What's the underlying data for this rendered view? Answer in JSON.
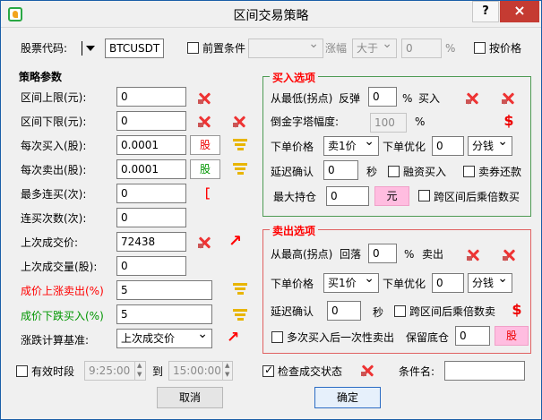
{
  "window": {
    "title": "区间交易策略",
    "help": "?",
    "close": "×"
  },
  "top": {
    "stock_code_label": "股票代码:",
    "symbol": "BTCUSDT",
    "pre_condition_label": "前置条件",
    "rise_label": "涨幅",
    "compare": "大于",
    "percent": "0",
    "percent_unit": "%",
    "by_price_label": "按价格"
  },
  "strategy": {
    "title": "策略参数",
    "rows": [
      {
        "label": "区间上限(元):",
        "value": "0"
      },
      {
        "label": "区间下限(元):",
        "value": "0"
      },
      {
        "label": "每次买入(股):",
        "value": "0.0001",
        "unit": "股"
      },
      {
        "label": "每次卖出(股):",
        "value": "0.0001",
        "unit": "股"
      },
      {
        "label": "最多连买(次):",
        "value": "0"
      },
      {
        "label": "连买次数(次):",
        "value": "0"
      },
      {
        "label": "上次成交价:",
        "value": "72438"
      },
      {
        "label": "上次成交量(股):",
        "value": "0"
      },
      {
        "label": "成价上涨卖出(%)",
        "value": "5"
      },
      {
        "label": "成价下跌买入(%)",
        "value": "5"
      },
      {
        "label": "涨跌计算基准:",
        "value": "上次成交价"
      }
    ]
  },
  "buy": {
    "title": "买入选项",
    "low_label": "从最低(拐点)",
    "rebound_label": "反弹",
    "rebound": "0",
    "percent": "%",
    "buy_label": "买入",
    "gold_label": "倒金字塔幅度:",
    "gold_value": "100",
    "gold_percent": "%",
    "order_price_label": "下单价格",
    "order_price": "卖1价",
    "optimize_label": "下单优化",
    "optimize": "0",
    "unit": "分钱",
    "delay_label": "延迟确认",
    "delay": "0",
    "seconds": "秒",
    "margin_buy": "融资买入",
    "sell_repay": "卖券还款",
    "max_pos_label": "最大持仓",
    "max_pos": "0",
    "yuan": "元",
    "multiply": "跨区间后乘倍数买"
  },
  "sell": {
    "title": "卖出选项",
    "high_label": "从最高(拐点)",
    "pullback_label": "回落",
    "pullback": "0",
    "percent": "%",
    "sell_label": "卖出",
    "order_price_label": "下单价格",
    "order_price": "买1价",
    "optimize_label": "下单优化",
    "optimize": "0",
    "unit": "分钱",
    "delay_label": "延迟确认",
    "delay": "0",
    "seconds": "秒",
    "multiply": "跨区间后乘倍数卖",
    "one_time": "多次买入后一次性卖出",
    "keep_label": "保留底仓",
    "keep": "0",
    "stock_unit": "股"
  },
  "bottom": {
    "valid_period": "有效时段",
    "start": "9:25:00",
    "to": "到",
    "end": "15:00:00",
    "check_status": "检查成交状态",
    "condition_name": "条件名:",
    "cancel": "取消",
    "confirm": "确定"
  }
}
